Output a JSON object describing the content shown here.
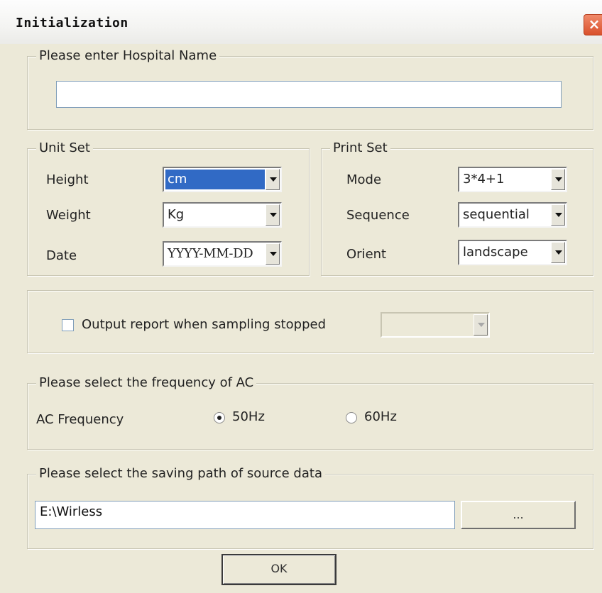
{
  "window": {
    "title": "Initialization",
    "close_glyph": "×"
  },
  "hospital": {
    "legend": "Please enter Hospital Name",
    "value": ""
  },
  "unit_set": {
    "legend": "Unit Set",
    "height_label": "Height",
    "height_value": "cm",
    "weight_label": "Weight",
    "weight_value": "Kg",
    "date_label": "Date",
    "date_value": "YYYY-MM-DD"
  },
  "print_set": {
    "legend": "Print Set",
    "mode_label": "Mode",
    "mode_value": "3*4+1",
    "sequence_label": "Sequence",
    "sequence_value": "sequential",
    "orient_label": "Orient",
    "orient_value": "landscape"
  },
  "output_report": {
    "label": "Output report when sampling stopped",
    "checked": false,
    "select_value": ""
  },
  "ac": {
    "legend": "Please select the frequency of AC",
    "label": "AC Frequency",
    "option_50": "50Hz",
    "option_60": "60Hz",
    "selected": "50Hz"
  },
  "saving_path": {
    "legend": "Please select the saving path of source data",
    "value": "E:\\Wirless",
    "browse_label": "..."
  },
  "ok_label": "OK"
}
